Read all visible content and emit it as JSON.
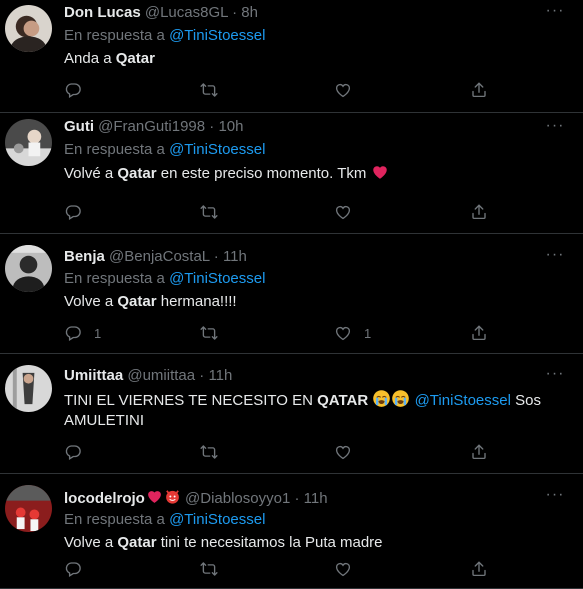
{
  "colors": {
    "background": "#000000",
    "text": "#e7e9ea",
    "muted": "#71767b",
    "link": "#1d9bf0",
    "divider": "#2f3336"
  },
  "reply_prefix": "En respuesta a",
  "tweets": [
    {
      "name": "Don Lucas",
      "handle": "@Lucas8GL",
      "dot": "·",
      "time": "8h",
      "reply_to": "@TiniStoessel",
      "text_pre": "Anda a ",
      "text_bold": "Qatar",
      "text_post": "",
      "reply_count": "",
      "retweet_count": "",
      "like_count": ""
    },
    {
      "name": "Guti",
      "handle": "@FranGuti1998",
      "dot": "·",
      "time": "10h",
      "reply_to": "@TiniStoessel",
      "text_pre": "Volvé a ",
      "text_bold": "Qatar",
      "text_post": " en este preciso momento. Tkm ",
      "reply_count": "",
      "retweet_count": "",
      "like_count": ""
    },
    {
      "name": "Benja",
      "handle": "@BenjaCostaL",
      "dot": "·",
      "time": "11h",
      "reply_to": "@TiniStoessel",
      "text_pre": "Volve a ",
      "text_bold": "Qatar",
      "text_post": " hermana!!!!",
      "reply_count": "1",
      "retweet_count": "",
      "like_count": "1"
    },
    {
      "name": "Umiittaa",
      "handle": "@umiittaa",
      "dot": "·",
      "time": "11h",
      "text_pre": "TINI EL VIERNES TE NECESITO EN ",
      "text_bold": "QATAR",
      "text_mention": "@TiniStoessel",
      "text_post": " Sos AMULETINI",
      "reply_count": "",
      "retweet_count": "",
      "like_count": ""
    },
    {
      "name": "locodelrojo",
      "handle": "@Diablosoyyo1",
      "dot": "·",
      "time": "11h",
      "reply_to": "@TiniStoessel",
      "text_pre": "Volve a ",
      "text_bold": "Qatar",
      "text_post": " tini te necesitamos la Puta madre",
      "reply_count": "",
      "retweet_count": "",
      "like_count": ""
    }
  ],
  "icons": {
    "more": "more-horizontal-icon",
    "reply": "reply-bubble-icon",
    "retweet": "retweet-icon",
    "like": "heart-outline-icon",
    "share": "share-upload-icon"
  }
}
